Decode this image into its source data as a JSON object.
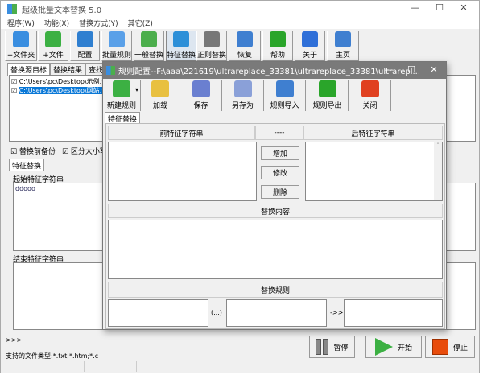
{
  "window": {
    "title": "超级批量文本替换 5.0",
    "minimize": "—",
    "maximize": "☐",
    "close": "✕"
  },
  "menu": [
    "程序(W)",
    "功能(X)",
    "替换方式(Y)",
    "其它(Z)"
  ],
  "toolbar": [
    {
      "label": "+文件夹",
      "icon": "folder-add-icon",
      "color": "#3a8ee0"
    },
    {
      "label": "+文件",
      "icon": "file-add-icon",
      "color": "#3cb043"
    },
    {
      "label": "配置",
      "icon": "gear-disc-icon",
      "color": "#2f7fd0"
    },
    {
      "label": "批量规则",
      "icon": "puzzle-icon",
      "color": "#5aa0e8"
    },
    {
      "label": "一般替换",
      "icon": "swap-icon",
      "color": "#4cae4c"
    },
    {
      "label": "特征替换",
      "icon": "hierarchy-icon",
      "color": "#2c8fd8"
    },
    {
      "label": "正则替换",
      "icon": "cart-icon",
      "color": "#777777"
    },
    {
      "label": "恢复",
      "icon": "undo-arrow-icon",
      "color": "#3f7fd0"
    },
    {
      "label": "帮助",
      "icon": "help-icon",
      "color": "#2aa52a"
    },
    {
      "label": "关于",
      "icon": "info-icon",
      "color": "#2f6fd8"
    },
    {
      "label": "主页",
      "icon": "home-icon",
      "color": "#3f7fd0"
    }
  ],
  "source_tabs": [
    "替换源目标",
    "替换结果",
    "查找"
  ],
  "files": [
    "C:\\Users\\pc\\Desktop\\示例.txt",
    "C:\\Users\\pc\\Desktop\\网站.txt"
  ],
  "options": {
    "backup": "替换前备份",
    "case": "区分大小写"
  },
  "mode_tab": "特征替换",
  "start_label": "起始特征字符串",
  "start_value": "ddooo",
  "end_label": "结束特征字符串",
  "log": ">>>",
  "filetypes": "支持的文件类型:*.txt;*.htm;*.c",
  "actions": {
    "pause": "暂停",
    "start": "开始",
    "stop": "停止"
  },
  "dialog": {
    "title": "规则配置--F:\\aaa\\221619\\ultrareplace_33381\\ultrareplace_33381\\ultrarepl...",
    "toolbar": [
      {
        "label": "新建规则",
        "icon": "plus-icon",
        "color": "#3cb043"
      },
      {
        "label": "加载",
        "icon": "open-folder-icon",
        "color": "#e8c040"
      },
      {
        "label": "保存",
        "icon": "save-icon",
        "color": "#6a7fd0"
      },
      {
        "label": "另存为",
        "icon": "save-as-icon",
        "color": "#8aa0d8"
      },
      {
        "label": "规则导入",
        "icon": "import-icon",
        "color": "#3f7fd0"
      },
      {
        "label": "规则导出",
        "icon": "export-icon",
        "color": "#2aa52a"
      },
      {
        "label": "关闭",
        "icon": "close-icon",
        "color": "#e04020"
      }
    ],
    "tab": "特征替换",
    "before_header": "前特征字符串",
    "sep_header": "----",
    "after_header": "后特征字符串",
    "add": "增加",
    "modify": "修改",
    "delete": "删除",
    "content_header": "替换内容",
    "rule_header": "替换规则",
    "ellipsis": "(...)",
    "arrow": "->>"
  }
}
